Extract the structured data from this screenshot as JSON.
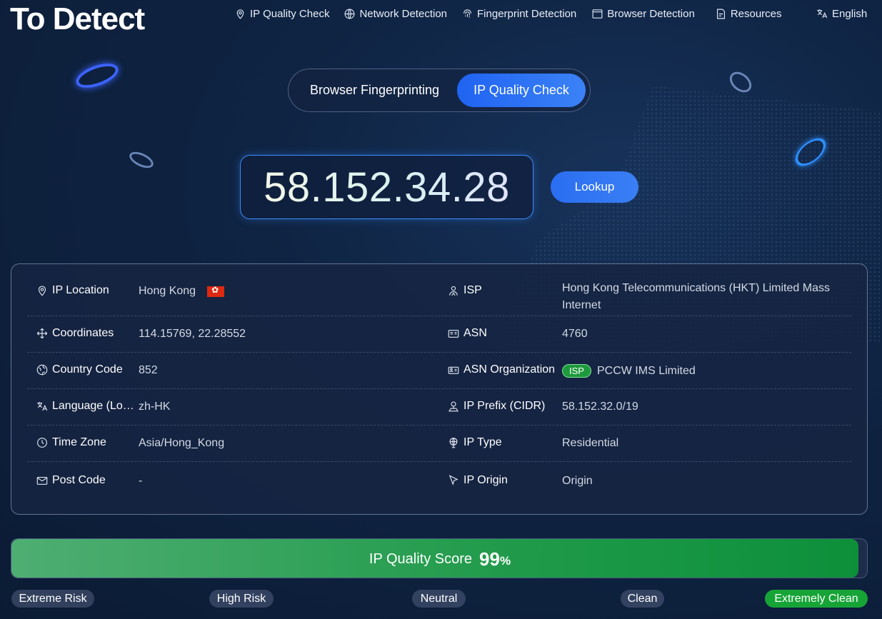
{
  "header": {
    "logo_main": "To Detect",
    "nav": [
      {
        "label": "IP Quality Check",
        "icon": "location-pin-icon"
      },
      {
        "label": "Network Detection",
        "icon": "globe-icon"
      },
      {
        "label": "Fingerprint Detection",
        "icon": "fingerprint-icon"
      },
      {
        "label": "Browser Detection",
        "icon": "browser-window-icon"
      },
      {
        "label": "Resources",
        "icon": "document-icon"
      }
    ],
    "language": "English"
  },
  "tabs": [
    {
      "label": "Browser Fingerprinting",
      "active": false
    },
    {
      "label": "IP Quality Check",
      "active": true
    }
  ],
  "ip_input": {
    "value": "58.152.34.28"
  },
  "lookup_label": "Lookup",
  "info": {
    "left": [
      {
        "label": "IP Location",
        "value": "Hong Kong",
        "icon": "location-pin-icon"
      },
      {
        "label": "Coordinates",
        "value": "114.15769, 22.28552",
        "icon": "move-arrows-icon"
      },
      {
        "label": "Country Code",
        "value": "852",
        "icon": "globe-icon"
      },
      {
        "label": "Language (Lo…",
        "value": "zh-HK",
        "icon": "translate-icon"
      },
      {
        "label": "Time Zone",
        "value": "Asia/Hong_Kong",
        "icon": "clock-icon"
      },
      {
        "label": "Post Code",
        "value": "-",
        "icon": "mail-icon"
      }
    ],
    "right": [
      {
        "label": "ISP",
        "value": "Hong Kong Telecommunications (HKT) Limited Mass Internet",
        "icon": "user-icon"
      },
      {
        "label": "ASN",
        "value": "4760",
        "icon": "id-card-icon"
      },
      {
        "label": "ASN Organization",
        "value": "PCCW IMS Limited",
        "badge": "ISP",
        "icon": "organization-icon"
      },
      {
        "label": "IP Prefix (CIDR)",
        "value": "58.152.32.0/19",
        "icon": "map-pin-icon"
      },
      {
        "label": "IP Type",
        "value": "Residential",
        "icon": "shield-globe-icon"
      },
      {
        "label": "IP Origin",
        "value": "Origin",
        "icon": "cursor-arrow-icon"
      }
    ]
  },
  "score": {
    "label": "IP Quality Score",
    "value": "99",
    "unit": "%",
    "fraction": 0.99
  },
  "risk_levels": [
    {
      "label": "Extreme Risk",
      "active": false
    },
    {
      "label": "High Risk",
      "active": false
    },
    {
      "label": "Neutral",
      "active": false
    },
    {
      "label": "Clean",
      "active": false
    },
    {
      "label": "Extremely Clean",
      "active": true
    }
  ],
  "colors": {
    "accent_blue": "#2a6ef2",
    "score_green": "#1f9a49",
    "badge_green": "#17a437",
    "hk_flag_red": "#de2910"
  }
}
